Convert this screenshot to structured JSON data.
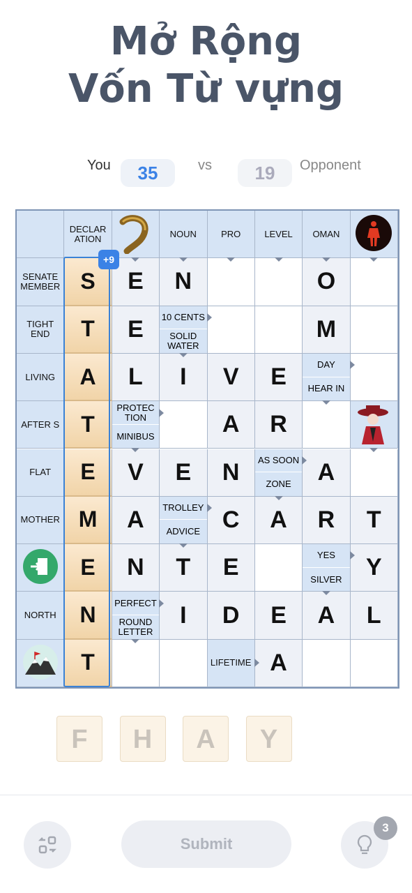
{
  "title": {
    "line1": "Mở Rộng",
    "line2": "Vốn Từ vựng"
  },
  "score": {
    "you_label": "You",
    "you": "35",
    "vs": "vs",
    "opponent": "19",
    "opponent_label": "Opponent"
  },
  "colors": {
    "accent": "#3b82e6",
    "clue_bg": "#d6e4f5",
    "tile": "#f1d4a8"
  },
  "bonus": "+9",
  "grid": [
    [
      {
        "t": "clue",
        "c": ""
      },
      {
        "t": "clue",
        "c": "DECLAR ATION"
      },
      {
        "t": "img",
        "icon": "eel-icon",
        "a": "d"
      },
      {
        "t": "clue",
        "c": "NOUN",
        "a": "d"
      },
      {
        "t": "clue",
        "c": "PRO",
        "a": "d"
      },
      {
        "t": "clue",
        "c": "LEVEL",
        "a": "d"
      },
      {
        "t": "clue",
        "c": "OMAN",
        "a": "d"
      },
      {
        "t": "img",
        "icon": "red-figure-icon",
        "a": "d"
      }
    ],
    [
      {
        "t": "clue",
        "c": "SENATE MEMBER"
      },
      {
        "t": "tile",
        "l": "S"
      },
      {
        "t": "letter",
        "l": "E"
      },
      {
        "t": "letter",
        "l": "N"
      },
      {
        "t": "empty"
      },
      {
        "t": "empty"
      },
      {
        "t": "letter",
        "l": "O"
      },
      {
        "t": "empty"
      }
    ],
    [
      {
        "t": "clue",
        "c": "TIGHT END"
      },
      {
        "t": "tile",
        "l": "T"
      },
      {
        "t": "letter",
        "l": "E"
      },
      {
        "t": "split",
        "top": "10 CENTS",
        "bottom": "SOLID WATER"
      },
      {
        "t": "empty"
      },
      {
        "t": "empty"
      },
      {
        "t": "letter",
        "l": "M"
      },
      {
        "t": "empty"
      }
    ],
    [
      {
        "t": "clue",
        "c": "LIVING"
      },
      {
        "t": "tile",
        "l": "A"
      },
      {
        "t": "letter",
        "l": "L"
      },
      {
        "t": "letter",
        "l": "I"
      },
      {
        "t": "letter",
        "l": "V"
      },
      {
        "t": "letter",
        "l": "E"
      },
      {
        "t": "split",
        "top": "DAY",
        "bottom": "HEAR IN"
      },
      {
        "t": "empty"
      }
    ],
    [
      {
        "t": "clue",
        "c": "AFTER S"
      },
      {
        "t": "tile",
        "l": "T"
      },
      {
        "t": "split",
        "top": "PROTEC TION",
        "bottom": "MINIBUS"
      },
      {
        "t": "empty"
      },
      {
        "t": "letter",
        "l": "A"
      },
      {
        "t": "letter",
        "l": "R"
      },
      {
        "t": "empty"
      },
      {
        "t": "img",
        "icon": "woman-hat-icon",
        "a": "d"
      }
    ],
    [
      {
        "t": "clue",
        "c": "FLAT"
      },
      {
        "t": "tile",
        "l": "E"
      },
      {
        "t": "letter",
        "l": "V"
      },
      {
        "t": "letter",
        "l": "E"
      },
      {
        "t": "letter",
        "l": "N"
      },
      {
        "t": "split",
        "top": "AS SOON",
        "bottom": "ZONE"
      },
      {
        "t": "letter",
        "l": "A"
      },
      {
        "t": "empty"
      }
    ],
    [
      {
        "t": "clue",
        "c": "MOTHER"
      },
      {
        "t": "tile",
        "l": "M"
      },
      {
        "t": "letter",
        "l": "A"
      },
      {
        "t": "split",
        "top": "TROLLEY",
        "bottom": "ADVICE"
      },
      {
        "t": "letter",
        "l": "C"
      },
      {
        "t": "letter",
        "l": "A"
      },
      {
        "t": "letter",
        "l": "R"
      },
      {
        "t": "letter",
        "l": "T"
      }
    ],
    [
      {
        "t": "img",
        "icon": "exit-door-icon"
      },
      {
        "t": "tile",
        "l": "E"
      },
      {
        "t": "letter",
        "l": "N"
      },
      {
        "t": "letter",
        "l": "T"
      },
      {
        "t": "letter",
        "l": "E"
      },
      {
        "t": "empty"
      },
      {
        "t": "split",
        "top": "YES",
        "bottom": "SILVER"
      },
      {
        "t": "letter",
        "l": "Y"
      }
    ],
    [
      {
        "t": "clue",
        "c": "NORTH"
      },
      {
        "t": "tile",
        "l": "N"
      },
      {
        "t": "split",
        "top": "PERFECT",
        "bottom": "ROUND LETTER"
      },
      {
        "t": "letter",
        "l": "I"
      },
      {
        "t": "letter",
        "l": "D"
      },
      {
        "t": "letter",
        "l": "E"
      },
      {
        "t": "letter",
        "l": "A"
      },
      {
        "t": "letter",
        "l": "L"
      }
    ],
    [
      {
        "t": "img",
        "icon": "mountain-icon"
      },
      {
        "t": "tile",
        "l": "T"
      },
      {
        "t": "empty"
      },
      {
        "t": "empty"
      },
      {
        "t": "clue",
        "c": "LIFETIME",
        "a": "r"
      },
      {
        "t": "letter",
        "l": "A"
      },
      {
        "t": "empty"
      },
      {
        "t": "empty"
      }
    ]
  ],
  "rack": [
    "F",
    "H",
    "A",
    "Y"
  ],
  "buttons": {
    "submit": "Submit",
    "hints": "3"
  }
}
